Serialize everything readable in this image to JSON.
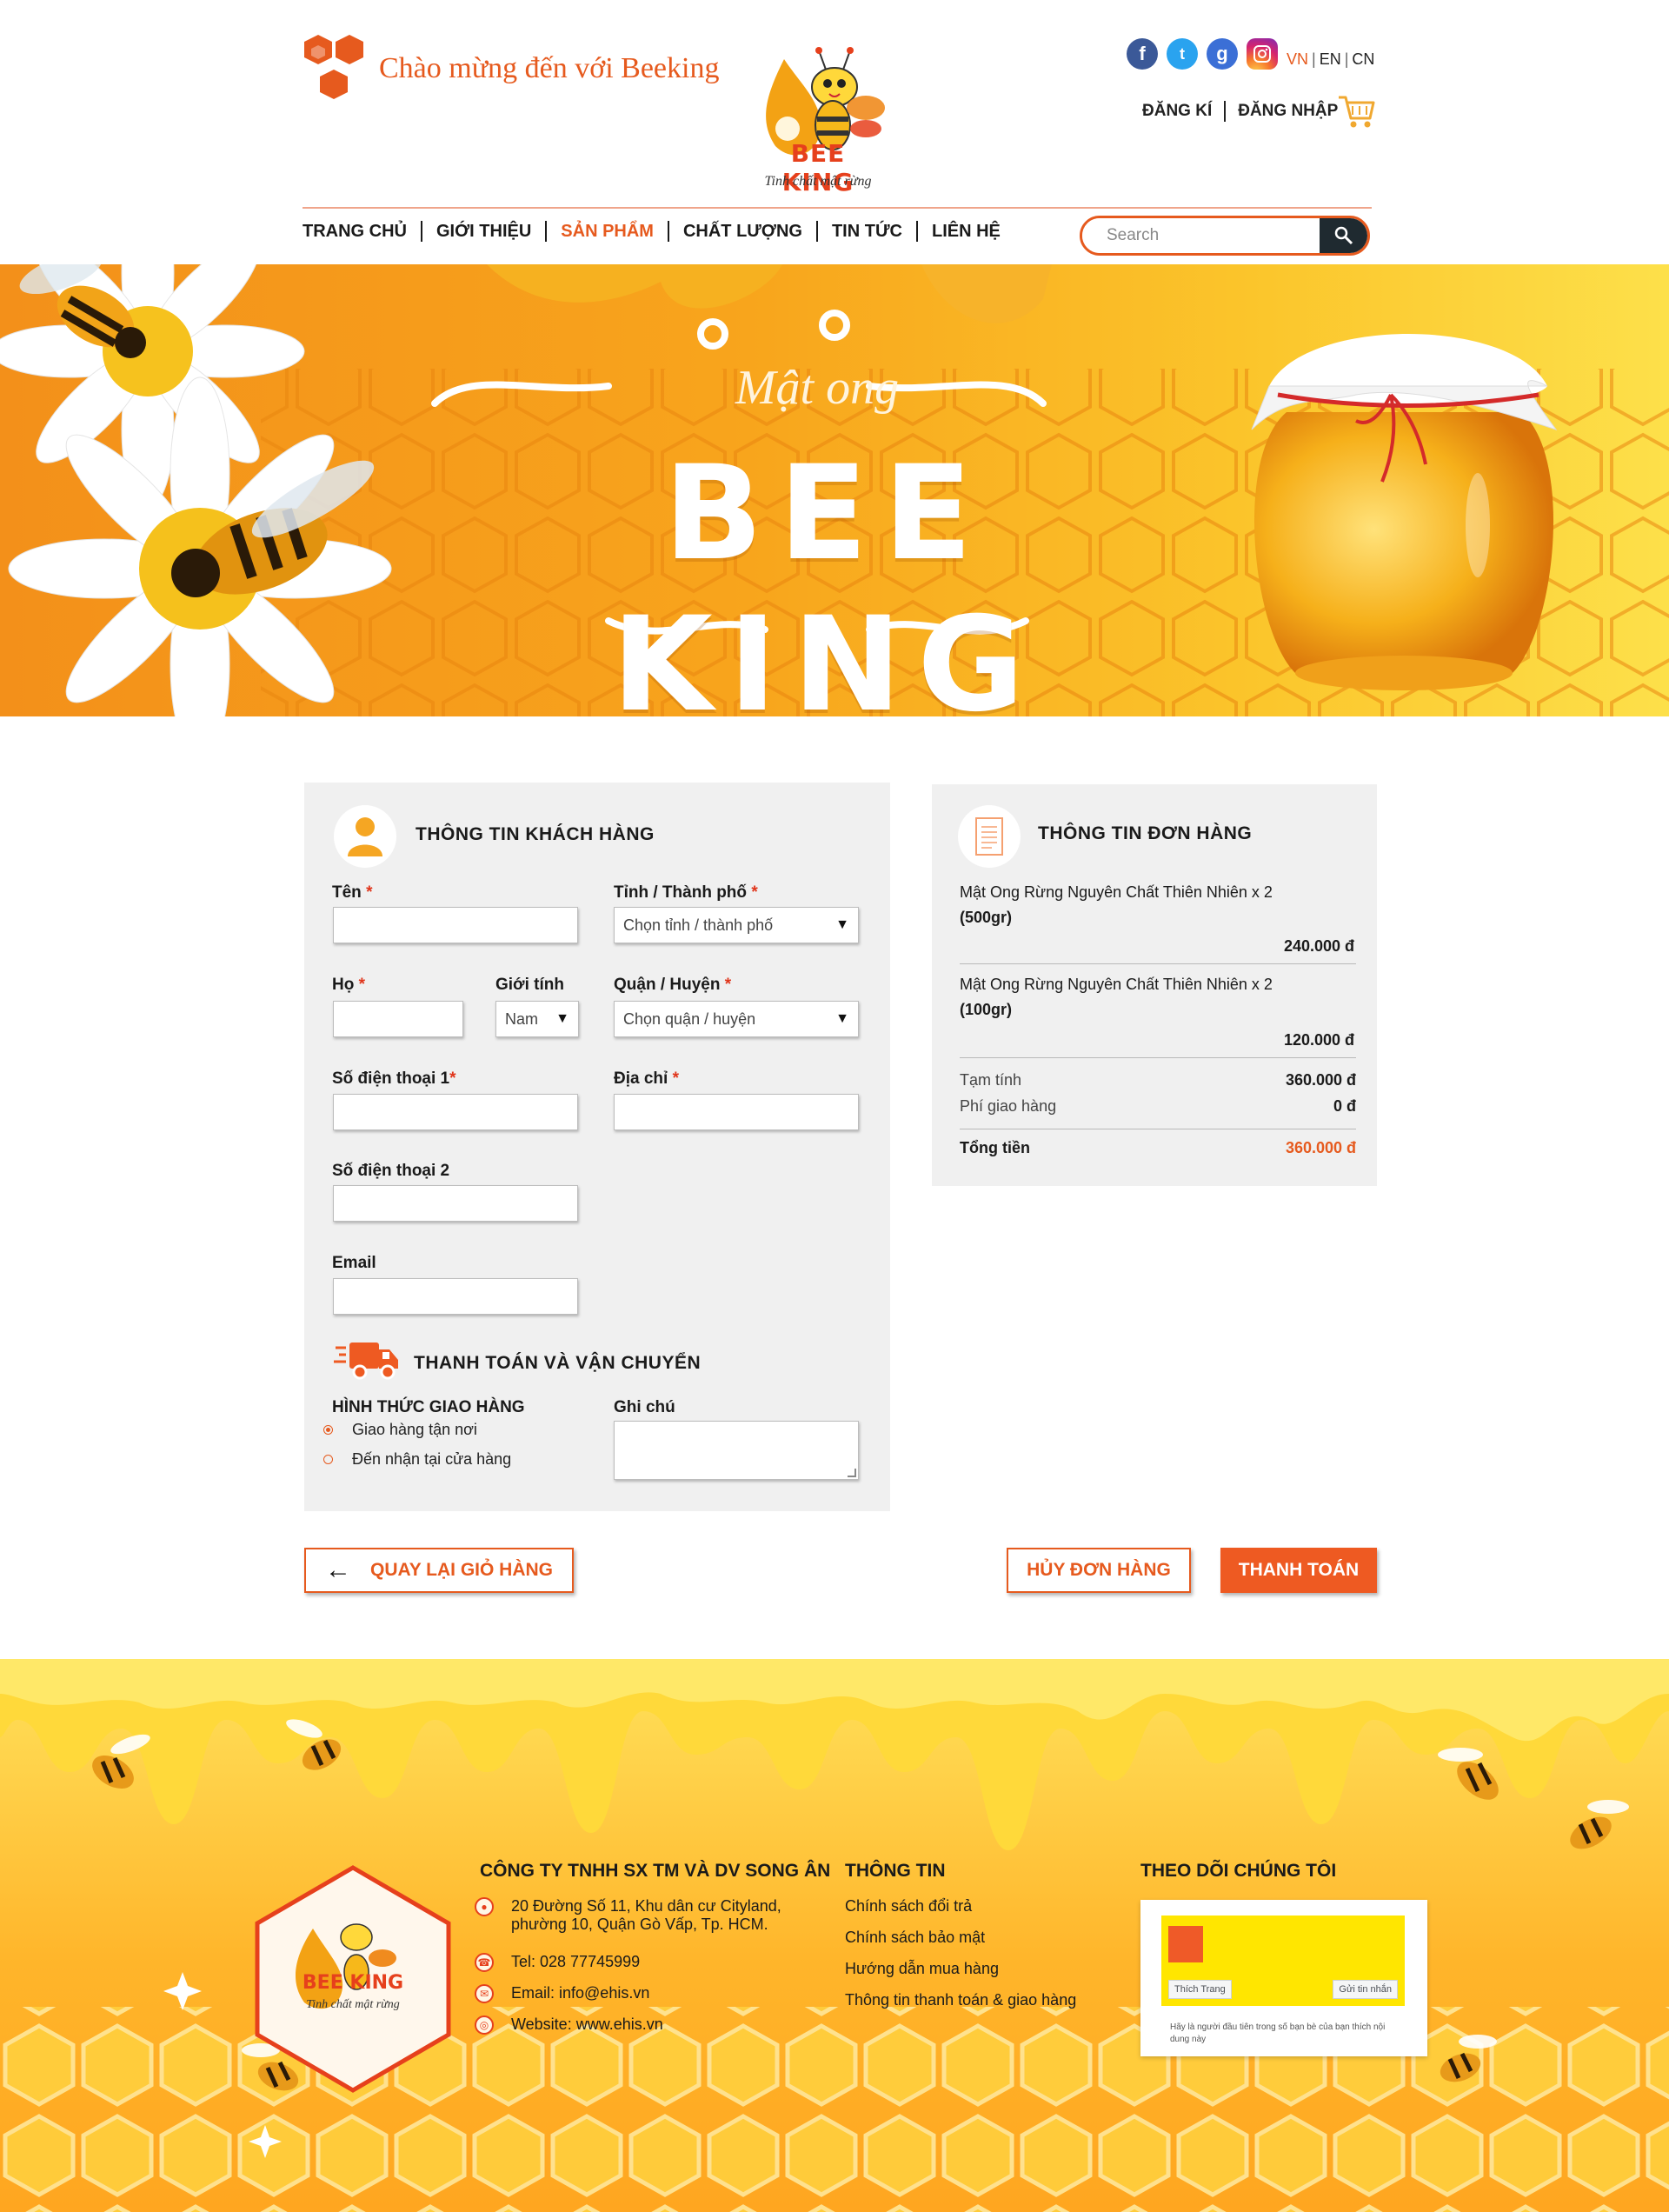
{
  "header": {
    "welcome": "Chào mừng đến với Beeking",
    "brand_name": "BEE KING",
    "brand_tagline": "Tinh chất mật rừng",
    "languages": [
      "VN",
      "EN",
      "CN"
    ],
    "active_language": "VN",
    "register": "ĐĂNG KÍ",
    "login": "ĐĂNG NHẬP",
    "nav": [
      "TRANG CHỦ",
      "GIỚI THIỆU",
      "SẢN PHẨM",
      "CHẤT LƯỢNG",
      "TIN TỨC",
      "LIÊN HỆ"
    ],
    "active_nav": "SẢN PHẨM",
    "search_placeholder": "Search",
    "social_icons": [
      "facebook-icon",
      "twitter-icon",
      "google-plus-icon",
      "instagram-icon"
    ]
  },
  "banner": {
    "script": "Mật ong",
    "title": "BEE KING"
  },
  "customer": {
    "heading": "THÔNG TIN KHÁCH HÀNG",
    "first_name_label": "Tên",
    "province_label": "Tỉnh / Thành phố",
    "province_value": "Chọn tỉnh / thành phố",
    "last_name_label": "Họ",
    "gender_label": "Giới tính",
    "gender_value": "Nam",
    "district_label": "Quận / Huyện",
    "district_value": "Chọn quận / huyện",
    "phone1_label": "Số điện thoại 1",
    "address_label": "Địa chỉ",
    "phone2_label": "Số điện thoại 2",
    "email_label": "Email",
    "required_mark": "*"
  },
  "shipping": {
    "heading": "THANH TOÁN VÀ VẬN CHUYỂN",
    "method_label": "HÌNH THỨC GIAO HÀNG",
    "options": [
      "Giao hàng tận nơi",
      "Đến nhận tại cửa hàng"
    ],
    "selected_option": "Giao hàng tận nơi",
    "note_label": "Ghi chú"
  },
  "order": {
    "heading": "THÔNG TIN ĐƠN HÀNG",
    "items": [
      {
        "name": "Mật Ong Rừng Nguyên Chất Thiên Nhiên x 2",
        "size": "(500gr)",
        "price": "240.000 đ"
      },
      {
        "name": "Mật Ong Rừng Nguyên Chất Thiên Nhiên x 2",
        "size": "(100gr)",
        "price": "120.000 đ"
      }
    ],
    "subtotal_label": "Tạm tính",
    "subtotal_value": "360.000 đ",
    "shipping_label": "Phí giao hàng",
    "shipping_value": "0 đ",
    "total_label": "Tổng tiền",
    "total_value": "360.000 đ"
  },
  "actions": {
    "back": "QUAY LẠI GIỎ HÀNG",
    "cancel": "HỦY ĐƠN HÀNG",
    "pay": "THANH TOÁN"
  },
  "footer": {
    "company": "CÔNG TY TNHH SX TM VÀ DV SONG ÂN",
    "address_line1": "20 Đường Số 11, Khu dân cư Cityland,",
    "address_line2": "phường 10, Quận Gò Vấp, Tp. HCM.",
    "tel": "Tel: 028 77745999",
    "email": "Email: info@ehis.vn",
    "website": "Website: www.ehis.vn",
    "info_title": "THÔNG TIN",
    "info_links": [
      "Chính sách đổi trả",
      "Chính sách bảo mật",
      "Hướng dẫn mua hàng",
      "Thông tin thanh toán & giao hàng"
    ],
    "follow_title": "THEO DÕI CHÚNG TÔI",
    "fb_like": "Thích Trang",
    "fb_message": "Gửi tin nhắn",
    "fb_note": "Hãy là người đầu tiên trong số bạn bè của bạn thích nội dung này",
    "brand_name": "BEE KING",
    "brand_tagline": "Tinh chất mật rừng"
  },
  "colors": {
    "accent": "#e65a1e",
    "panel": "#f0f0f0",
    "honey": "#f8a51c"
  }
}
